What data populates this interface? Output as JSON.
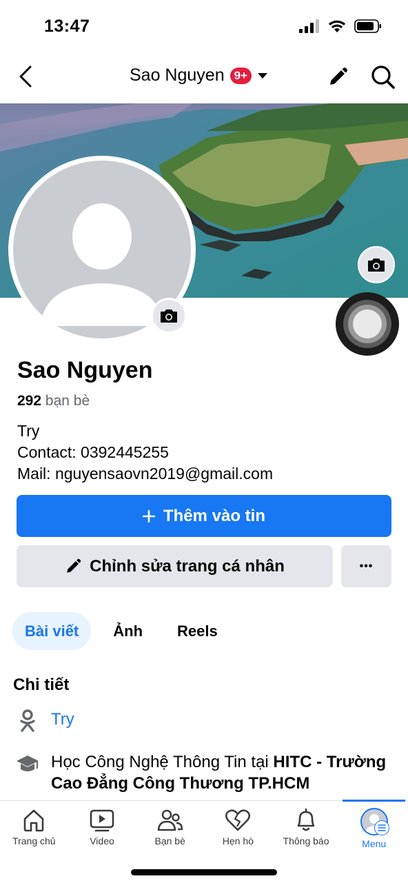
{
  "status_bar": {
    "time": "13:47"
  },
  "header": {
    "title": "Sao Nguyen",
    "notification_badge": "9+"
  },
  "profile": {
    "name": "Sao Nguyen",
    "friends_count": "292",
    "friends_label": "bạn bè",
    "bio_lines": [
      "Try",
      "Contact: 0392445255",
      "Mail: nguyensaovn2019@gmail.com"
    ]
  },
  "actions": {
    "add_story": "Thêm vào tin",
    "edit_profile": "Chỉnh sửa trang cá nhân",
    "more": "•••"
  },
  "tabs": [
    {
      "label": "Bài viết",
      "active": true
    },
    {
      "label": "Ảnh",
      "active": false
    },
    {
      "label": "Reels",
      "active": false
    }
  ],
  "details": {
    "title": "Chi tiết",
    "items": [
      {
        "icon": "odnoklassniki-icon",
        "text": "Try"
      },
      {
        "icon": "graduation-cap-icon",
        "text_prefix": "Học Công Nghệ Thông Tin tại ",
        "text_bold": "HITC - Trường Cao Đẳng Công Thương TP.HCM"
      }
    ]
  },
  "bottom_nav": [
    {
      "label": "Trang chủ",
      "icon": "home-icon"
    },
    {
      "label": "Video",
      "icon": "video-icon"
    },
    {
      "label": "Bạn bè",
      "icon": "friends-icon"
    },
    {
      "label": "Hẹn hò",
      "icon": "dating-heart-icon"
    },
    {
      "label": "Thông báo",
      "icon": "bell-icon"
    },
    {
      "label": "Menu",
      "icon": "menu-avatar-icon",
      "active": true
    }
  ],
  "colors": {
    "accent": "#1877f2",
    "badge": "#e41e3f",
    "button_gray": "#e4e6eb"
  }
}
